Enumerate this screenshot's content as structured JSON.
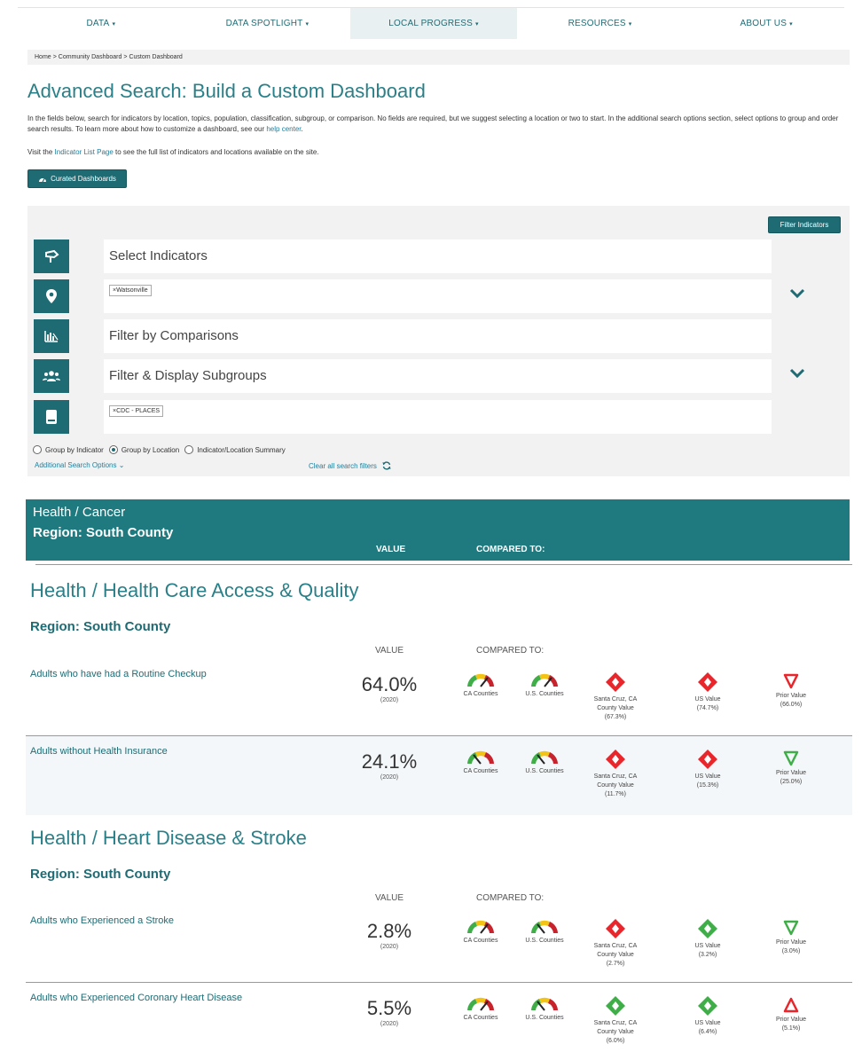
{
  "nav": {
    "items": [
      {
        "label": "DATA",
        "active": false
      },
      {
        "label": "DATA SPOTLIGHT",
        "active": false
      },
      {
        "label": "LOCAL PROGRESS",
        "active": true
      },
      {
        "label": "RESOURCES",
        "active": false
      },
      {
        "label": "ABOUT US",
        "active": false
      }
    ],
    "caret": "▾"
  },
  "breadcrumb": {
    "home": "Home",
    "sep": ">",
    "community": "Community Dashboard",
    "current": "Custom Dashboard"
  },
  "page": {
    "title": "Advanced Search: Build a Custom Dashboard",
    "intro_text": "In the fields below, search for indicators by location, topics, population, classification, subgroup, or comparison. No fields are required, but we suggest selecting a location or two to start. In the additional search options section, select options to group and order search results. To learn more about how to customize a dashboard, see our ",
    "help_link": "help center",
    "intro_end": ".",
    "visit_pre": "Visit the ",
    "visit_link": "Indicator List Page",
    "visit_post": " to see the full list of indicators and locations available on the site.",
    "curated_label": "Curated Dashboards"
  },
  "search": {
    "filter_button": "Filter Indicators",
    "indicators_placeholder": "Select Indicators",
    "location_tag": "×Watsonville",
    "comparisons_placeholder": "Filter by Comparisons",
    "subgroups_placeholder": "Filter & Display Subgroups",
    "source_tag": "×CDC - PLACES",
    "group_options": [
      {
        "label": "Group by Indicator",
        "selected": false
      },
      {
        "label": "Group by Location",
        "selected": true
      },
      {
        "label": "Indicator/Location Summary",
        "selected": false
      }
    ],
    "additional_options": "Additional Search Options",
    "additional_caret": "⌄",
    "clear_filters": "Clear all search filters"
  },
  "cancer": {
    "title": "Health / Cancer",
    "region": "Region: South County",
    "value_head": "VALUE",
    "compared_head": "COMPARED TO:"
  },
  "sections": [
    {
      "title": "Health / Health Care Access & Quality",
      "region": "Region: South County",
      "value_head": "VALUE",
      "compared_head": "COMPARED TO:",
      "rows": [
        {
          "name": "Adults who have had a Routine Checkup",
          "value": "64.0%",
          "year": "(2020)",
          "ca_label": "CA Counties",
          "us_label": "U.S. Counties",
          "ca_gauge": "right",
          "us_gauge": "right",
          "county_icon": "red-diamond",
          "county_label": [
            "Santa Cruz, CA",
            "County Value",
            "(67.3%)"
          ],
          "usvalue_icon": "red-diamond",
          "usvalue_label": [
            "US Value",
            "(74.7%)"
          ],
          "prior_icon": "red-down",
          "prior_label": [
            "Prior Value",
            "(66.0%)"
          ]
        },
        {
          "name": "Adults without Health Insurance",
          "value": "24.1%",
          "year": "(2020)",
          "ca_label": "CA Counties",
          "us_label": "U.S. Counties",
          "ca_gauge": "left",
          "us_gauge": "left",
          "county_icon": "red-diamond",
          "county_label": [
            "Santa Cruz, CA",
            "County Value",
            "(11.7%)"
          ],
          "usvalue_icon": "red-diamond",
          "usvalue_label": [
            "US Value",
            "(15.3%)"
          ],
          "prior_icon": "green-down",
          "prior_label": [
            "Prior Value",
            "(25.0%)"
          ]
        }
      ]
    },
    {
      "title": "Health / Heart Disease & Stroke",
      "region": "Region: South County",
      "value_head": "VALUE",
      "compared_head": "COMPARED TO:",
      "rows": [
        {
          "name": "Adults who Experienced a Stroke",
          "value": "2.8%",
          "year": "(2020)",
          "ca_label": "CA Counties",
          "us_label": "U.S. Counties",
          "ca_gauge": "right",
          "us_gauge": "left",
          "county_icon": "red-diamond",
          "county_label": [
            "Santa Cruz, CA",
            "County Value",
            "(2.7%)"
          ],
          "usvalue_icon": "green-diamond",
          "usvalue_label": [
            "US Value",
            "(3.2%)"
          ],
          "prior_icon": "green-down",
          "prior_label": [
            "Prior Value",
            "(3.0%)"
          ]
        },
        {
          "name": "Adults who Experienced Coronary Heart Disease",
          "value": "5.5%",
          "year": "(2020)",
          "ca_label": "CA Counties",
          "us_label": "U.S. Counties",
          "ca_gauge": "right",
          "us_gauge": "left",
          "county_icon": "green-diamond",
          "county_label": [
            "Santa Cruz, CA",
            "County Value",
            "(6.0%)"
          ],
          "usvalue_icon": "green-diamond",
          "usvalue_label": [
            "US Value",
            "(6.4%)"
          ],
          "prior_icon": "red-up",
          "prior_label": [
            "Prior Value",
            "(5.1%)"
          ]
        }
      ]
    }
  ],
  "colors": {
    "teal": "#1f6b74",
    "title_teal": "#2a8088",
    "link": "#1e7f9e",
    "red": "#e8262b",
    "green": "#3fae49"
  }
}
